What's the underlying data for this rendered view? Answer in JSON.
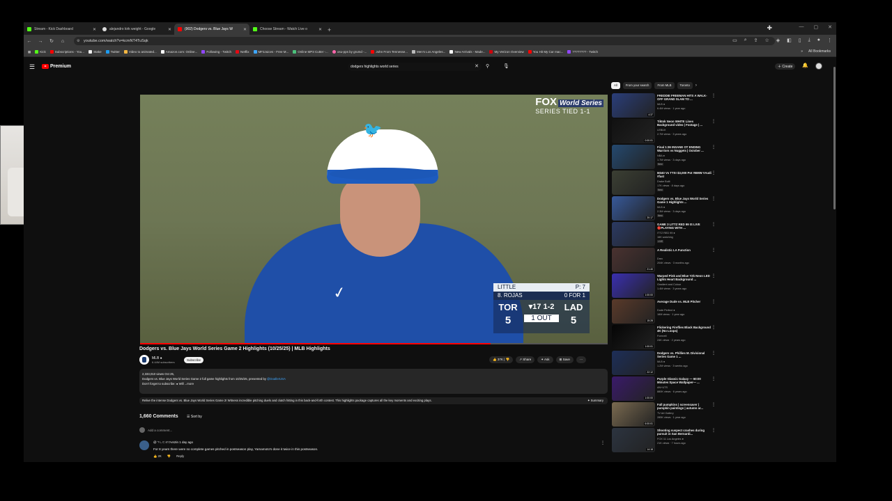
{
  "browser": {
    "tabs": [
      {
        "title": "Stream - Kick Dashboard",
        "color": "#53fc18"
      },
      {
        "title": "alejandro kirk weight - Google",
        "color": "#dddddd"
      },
      {
        "title": "(902) Dodgers vs. Blue Jays W",
        "color": "#ff0000",
        "active": true
      },
      {
        "title": "Choose Stream - Watch Live o",
        "color": "#53fc18"
      }
    ],
    "url": "youtube.com/watch?v=kcmNT4TuSqk",
    "bookmarks": [
      "Kick",
      "Subscriptions - You...",
      "Stake",
      "Twitter",
      "Video to animated...",
      "Amazon.com: Online...",
      "Following - Twitch",
      "Netflix",
      "MF3Juices - Free M...",
      "Online MP3 Cutter -...",
      "osu-pps by grumd -...",
      "John From Tennesse...",
      "Men's Los Angeles...",
      "New Arrivals - Made...",
      "My Verizon Overview",
      "You Hit My Car mac...",
      "???????? - Twitch"
    ],
    "all_bookmarks": "All Bookmarks"
  },
  "youtube": {
    "brand": "Premium",
    "search_query": "dodgers highlights world series",
    "create_label": "Create"
  },
  "video": {
    "fox_logo": "FOX",
    "ws_logo": "World Series",
    "series_status": "SERIES TIED 1-1",
    "scorebug": {
      "pitcher": "LITTLE",
      "pitch_count": "P: 7",
      "batter": "8. ROJAS",
      "batter_line": "0 FOR 1",
      "away_team": "TOR",
      "away_score": "5",
      "home_team": "LAD",
      "home_score": "5",
      "inning": "▾17 1-2",
      "outs": "1 OUT"
    },
    "progress_fraction": 0.75,
    "title": "Dodgers vs. Blue Jays World Series Game 2 Highlights (10/25/25) | MLB Highlights",
    "channel": "MLB",
    "channel_verified": "●",
    "subscribers": "6.44M subscribers",
    "subscribe_label": "Subscribe",
    "likes": "37K",
    "share_label": "Share",
    "ask_label": "Ask",
    "save_label": "Save"
  },
  "description": {
    "stats": "2,333,010 views  Oct 25,",
    "line1": "Dodgers vs. Blue Jays World Series Game 2 full game highlights from 10/25/25, presented by ",
    "sponsor": "@DoallerUSA",
    "line2": "Don't forget to subscribe: ●  Will ...more",
    "summary": "Relive the intense Dodgers vs. Blue Jays World Series Game 2! Witness incredible pitching duels and clutch hitting in this back-and-forth contest. This highlights package captures all the key moments and exciting plays.",
    "summary_btn": "✦ Summary"
  },
  "comments": {
    "count": "1,660 Comments",
    "sort_label": "Sort by",
    "add_placeholder": "Add a comment...",
    "first": {
      "author": "@ㄱㄴㄷㄹㅁvn2in  1 day ago",
      "text": "For 8 years there were no complete games pitched in postseason play, Yamamoto's done it twice in this postseason.",
      "likes": "2K",
      "reply": "Reply"
    }
  },
  "sidebar": {
    "chips": [
      "All",
      "From your search",
      "From MLB",
      "Toronto"
    ],
    "items": [
      {
        "title": "FREDDIE FREEMAN HITS A WALK-OFF GRAND SLAM TO ...",
        "channel": "MLB ●",
        "meta": "6.4M views · 1 year ago",
        "dur": "4:37",
        "color": "#2a3e7a"
      },
      {
        "title": "Tiktok Neon WHITE Lines Background video | Footage | ...",
        "channel": "LEBUX",
        "meta": "2.7M views · 3 years ago",
        "dur": "0:00:01",
        "color": "#111111"
      },
      {
        "title": "Final 1:36 INSANE OT ENDING Warriors vs Nuggets | October ...",
        "channel": "NBA ●",
        "meta": "1.7M views · 3 days ago",
        "dur": "",
        "badge": "New",
        "color": "#24496f"
      },
      {
        "title": "M340 Vs TTS! $3,000 Pot #BMW #Audi #fast",
        "channel": "Drake Built",
        "meta": "17K views · 8 days ago",
        "dur": "",
        "badge": "New",
        "color": "#3b3f33"
      },
      {
        "title": "Dodgers vs. Blue Jays World Series Game 1 Highlights ...",
        "channel": "MLB ●",
        "meta": "2.3M views · 3 days ago",
        "dur": "20:17",
        "badge": "New",
        "color": "#37599a"
      },
      {
        "title": "GAME 3 LITTZ RED 99 IS LIVE 🔴PLAYING WITH ...",
        "channel": "ITTZ RED 99 ●",
        "meta": "16K watching",
        "dur": "",
        "badge": "LIVE",
        "color": "#2b3a63"
      },
      {
        "title": "A Realistic LA Function",
        "channel": "Drex",
        "meta": "204K views · 3 months ago",
        "dur": "21:40",
        "color": "#4a3230"
      },
      {
        "title": "Warped Pink and Blue Y2k Neon LED Lights Heart Background ...",
        "channel": "Gradient and Colour",
        "meta": "1.4M views · 3 years ago",
        "dur": "1:00:00",
        "color": "#3a2fb0"
      },
      {
        "title": "Average Dude vs. MLB Pitcher",
        "channel": "Dude Perfect ●",
        "meta": "16M views · 1 year ago",
        "dur": "15:28",
        "color": "#5a3a2a"
      },
      {
        "title": "Flickering Fireflies Black Background 4K (No Loops)",
        "channel": "Forevell",
        "meta": "24K views · 2 years ago",
        "dur": "1:00:01",
        "color": "#050505"
      },
      {
        "title": "Dodgers vs. Phillies M. Divisional Series Game 1 ...",
        "channel": "MLB ●",
        "meta": "1.2M views · 3 weeks ago",
        "dur": "22:12",
        "color": "#1d2e58"
      },
      {
        "title": "Purple Glassic Galaxy — 60:00 Minutes Space Wallpaper— ...",
        "channel": "AN+UTS",
        "meta": "880K views · 6 years ago",
        "dur": "1:00:00",
        "color": "#3a1a6a"
      },
      {
        "title": "Fall pumpkins | screensaver | pumpkin paintings | autumn ar...",
        "channel": "TV Art Gallery",
        "meta": "285K views · 1 year ago",
        "dur": "6:00:01",
        "color": "#7a6a50"
      },
      {
        "title": "Shooting suspect crashes during pursuit in San Bernardi...",
        "channel": "FOX 11 Los Angeles ●",
        "meta": "21K views · 7 hours ago",
        "dur": "14:18",
        "color": "#2c3440"
      }
    ]
  }
}
